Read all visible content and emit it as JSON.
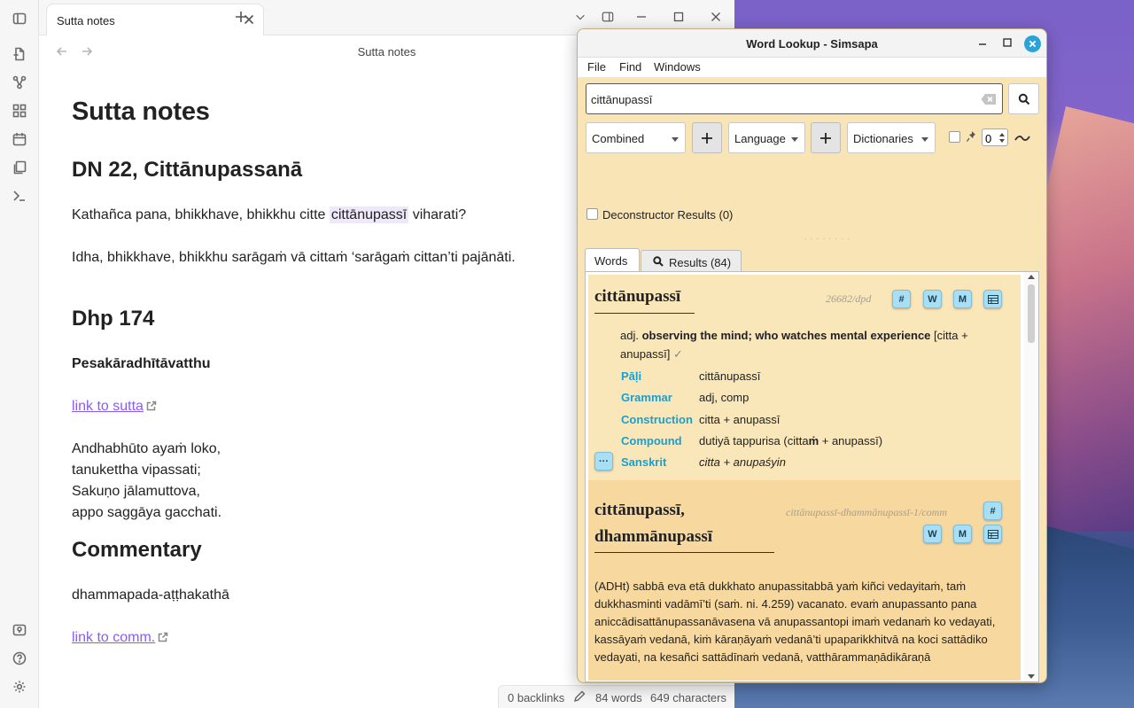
{
  "editor": {
    "tab_title": "Sutta notes",
    "nav_title": "Sutta notes",
    "note": {
      "title": "Sutta notes",
      "h2_dn": "DN 22, Cittānupassanā",
      "p1_before": "Kathañca pana, bhikkhave, bhikkhu citte ",
      "p1_highlight": "cittānupassī",
      "p1_after": " viharati?",
      "p2": "Idha, bhikkhave, bhikkhu sarāgaṁ vā cittaṁ ‘sarāgaṁ cittan’ti pajānāti.",
      "h2_dhp": "Dhp 174",
      "h3_story": "Pesakāradhītāvatthu",
      "link_sutta": "link to sutta",
      "verse": [
        "Andhabhūto ayaṁ loko,",
        "tanukettha vipassati;",
        "Sakuṇo jālamuttova,",
        "appo saggāya gacchati."
      ],
      "h2_comm": "Commentary",
      "comm_text": "dhammapada-aṭṭhakathā",
      "link_comm": "link to comm."
    },
    "status": {
      "backlinks": "0 backlinks",
      "words": "84 words",
      "characters": "649 characters"
    }
  },
  "lookup": {
    "window_title": "Word Lookup - Simsapa",
    "menu": [
      "File",
      "Find",
      "Windows"
    ],
    "search_value": "cittānupassī",
    "mode_select": "Combined",
    "language_select": "Language",
    "dictionaries_select": "Dictionaries",
    "spin_value": "0",
    "deconstructor_label": "Deconstructor Results (0)",
    "tabs": {
      "words": "Words",
      "results": "Results (84)"
    },
    "entry1": {
      "headword": "cittānupassī",
      "id": "26682/dpd",
      "buttons": [
        "#",
        "W",
        "M"
      ],
      "def_pos": "adj.",
      "def_meaning": "observing the mind; who watches mental experience",
      "def_construction": "[citta + anupassī]",
      "def_check": "✓",
      "grammar": [
        {
          "key": "Pāḷi",
          "value": "cittānupassī"
        },
        {
          "key": "Grammar",
          "value": "adj, comp"
        },
        {
          "key": "Construction",
          "value": "citta + anupassī"
        },
        {
          "key": "Compound",
          "value_before": "dutiyā tappurisa (citta",
          "value_bold": "ṁ",
          "value_after": " + anupassī)"
        },
        {
          "key": "Sanskrit",
          "value": "citta + anupaśyin"
        }
      ],
      "more_button": "···"
    },
    "entry2": {
      "headword_line1": "cittānupassī,",
      "headword_line2": "dhammānupassī",
      "id": "cittānupassī-dhammānupassī-1/comm",
      "buttons": [
        "#",
        "W",
        "M"
      ],
      "text": "(ADHt) sabbā eva etā dukkhato anupassitabbā yaṁ kiñci vedayitaṁ, taṁ dukkhasminti vadāmī’ti (saṁ. ni. 4.259) vacanato. evaṁ anupassanto pana aniccādisattānupassanāvasena vā anupassantopi imaṁ vedanaṁ ko vedayati, kassāyaṁ vedanā, kiṁ kāraṇāyaṁ vedanā’ti upaparikkhitvā na koci sattādiko vedayati, na kesañci sattādīnaṁ vedanā, vatthārammaṇādikāraṇā"
    }
  }
}
